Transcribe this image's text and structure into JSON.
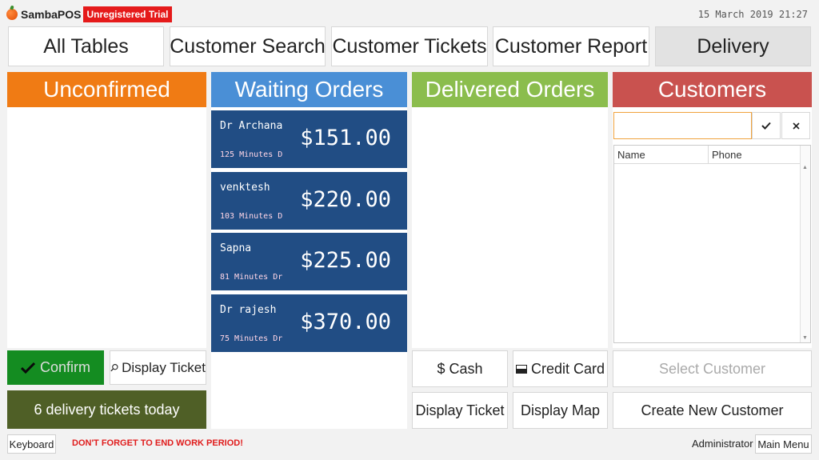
{
  "header": {
    "app_name": "SambaPOS",
    "trial_badge": "Unregistered Trial",
    "datetime": "15 March 2019 21:27"
  },
  "nav": {
    "all_tables": "All Tables",
    "customer_search": "Customer Search",
    "customer_tickets": "Customer Tickets",
    "customer_report": "Customer Report",
    "delivery": "Delivery"
  },
  "columns": {
    "unconfirmed": "Unconfirmed",
    "waiting": "Waiting Orders",
    "delivered": "Delivered Orders",
    "customers": "Customers"
  },
  "orders": [
    {
      "name": "Dr Archana",
      "sub": "125 Minutes D",
      "amount": "$151.00"
    },
    {
      "name": "venktesh",
      "sub": "103 Minutes D",
      "amount": "$220.00"
    },
    {
      "name": "Sapna",
      "sub": "81 Minutes Dr",
      "amount": "$225.00"
    },
    {
      "name": "Dr rajesh",
      "sub": "75 Minutes Dr",
      "amount": "$370.00"
    }
  ],
  "unconfirmed_actions": {
    "confirm": "Confirm",
    "display_ticket": "Display Ticket",
    "delivery_count": "6 delivery tickets today"
  },
  "delivered_actions": {
    "cash": "$ Cash",
    "credit_card": "Credit Card",
    "display_ticket": "Display Ticket",
    "display_map": "Display Map"
  },
  "customers": {
    "search_value": "",
    "columns": [
      "Name",
      "Phone"
    ],
    "select_customer": "Select Customer",
    "create_customer": "Create New Customer"
  },
  "footer": {
    "keyboard": "Keyboard",
    "warning": "DON'T FORGET TO END WORK PERIOD!",
    "user": "Administrator",
    "main_menu": "Main Menu"
  },
  "colors": {
    "unconfirmed": "#f07b14",
    "waiting": "#4a8fd6",
    "delivered": "#8bbd4d",
    "customers": "#c9524f",
    "order_card": "#214d84",
    "confirm": "#148c21",
    "count_box": "#4f5f26",
    "trial_badge": "#e51a1a",
    "warning": "#e01b1b"
  }
}
